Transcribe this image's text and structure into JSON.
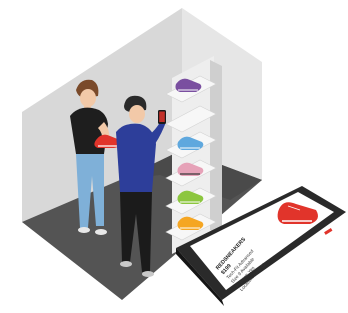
{
  "phone": {
    "title": "REDSNEAKERS",
    "price": "$199",
    "lines": [
      "Tech-Fit Advanced",
      "Size 9 Available",
      "In Store: Yes",
      "Location: Aisle 02"
    ]
  },
  "colors": {
    "floor": "#555555",
    "wall_left": "#d9d9d9",
    "wall_right": "#e4e4e4",
    "accent_red": "#e1342b",
    "shirt_blue": "#2d3e9a",
    "jeans_blue": "#7fb0d8"
  }
}
